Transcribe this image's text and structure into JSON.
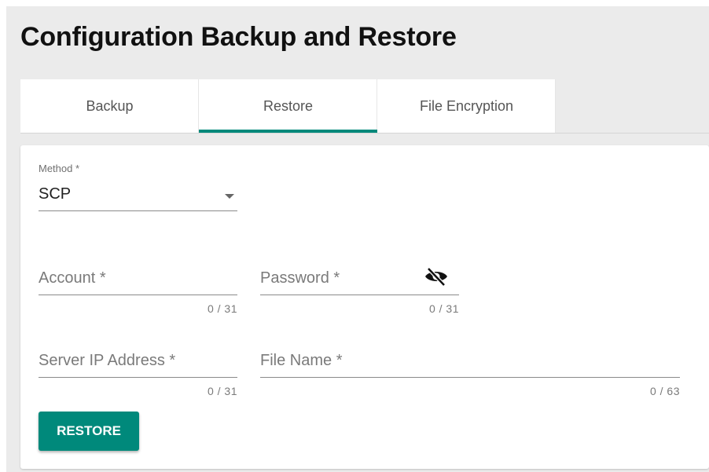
{
  "page_title": "Configuration Backup and Restore",
  "tabs": [
    {
      "label": "Backup",
      "active": false
    },
    {
      "label": "Restore",
      "active": true
    },
    {
      "label": "File Encryption",
      "active": false
    }
  ],
  "form": {
    "method": {
      "label": "Method *",
      "value": "SCP"
    },
    "account": {
      "placeholder": "Account *",
      "counter": "0 / 31"
    },
    "password": {
      "placeholder": "Password *",
      "counter": "0 / 31",
      "icon": "eye-off-icon"
    },
    "server_ip": {
      "placeholder": "Server IP Address *",
      "counter": "0 / 31"
    },
    "file_name": {
      "placeholder": "File Name *",
      "counter": "0 / 63"
    }
  },
  "restore_button": "RESTORE",
  "colors": {
    "accent": "#00897b",
    "background": "#ebebeb"
  }
}
